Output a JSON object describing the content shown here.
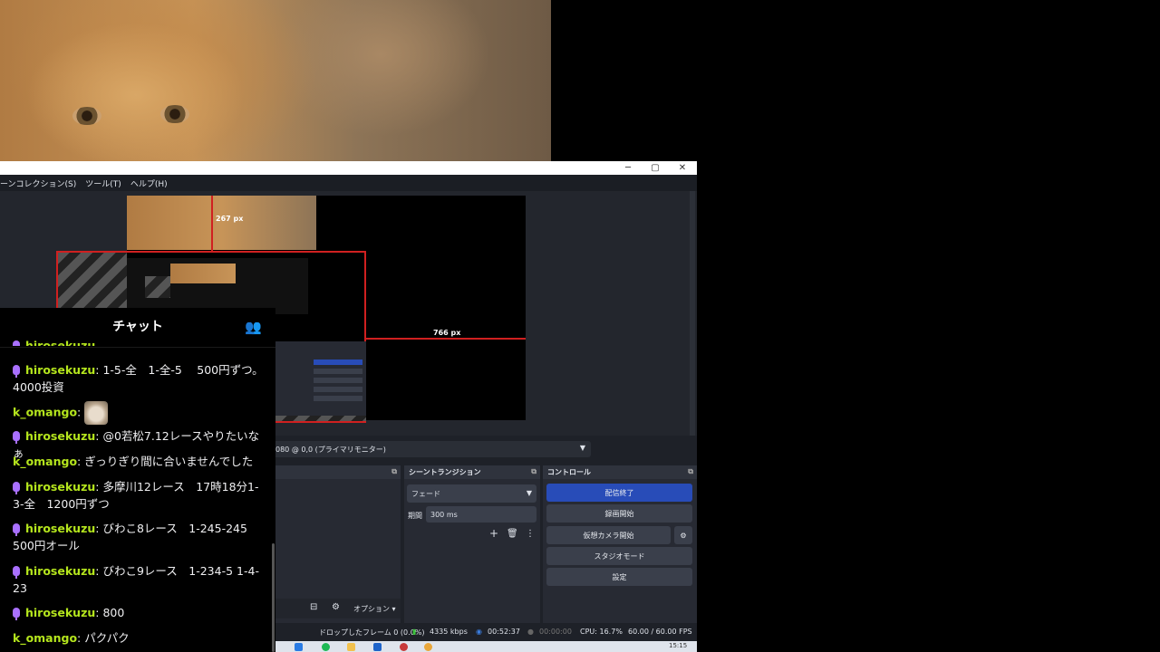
{
  "obs": {
    "window_controls": {
      "minimize": "─",
      "maximize": "▢",
      "close": "✕"
    },
    "menu": [
      "ーンコレクション(S)",
      "ツール(T)",
      "ヘルプ(H)"
    ],
    "preview": {
      "dim_vertical": "267 px",
      "dim_horizontal": "766 px"
    },
    "monitor_select": "080 @ 0,0 (プライマリモニター)",
    "sources_toolbar": {
      "options_label": "オプション ▾"
    },
    "scene_transition": {
      "title": "シーントランジション",
      "type_value": "フェード",
      "duration_label": "期間",
      "duration_value": "300 ms"
    },
    "controls": {
      "title": "コントロール",
      "buttons": [
        "配信終了",
        "録画開始",
        "仮想カメラ開始",
        "スタジオモード",
        "設定"
      ]
    },
    "status": {
      "dropped": "ドロップしたフレーム 0 (0.0%)",
      "bitrate": "4335 kbps",
      "stream_time": "00:52:37",
      "rec_time": "00:00:00",
      "cpu": "CPU: 16.7%",
      "fps": "60.00 / 60.00 FPS"
    },
    "taskbar_clock": "15:15"
  },
  "chat": {
    "title": "チャット",
    "messages": [
      {
        "user": "hirosekuzu",
        "text": "1-5-全　1-全-5　 500円ずつ。4000投資",
        "mic": true
      },
      {
        "user": "k_omango",
        "text": "",
        "mic": false,
        "emote": "cat"
      },
      {
        "user": "hirosekuzu",
        "text": "@0若松7.12レースやりたいなぁ",
        "mic": true
      },
      {
        "user": "k_omango",
        "text": "ぎっりぎり間に合いませんでした",
        "mic": false
      },
      {
        "user": "hirosekuzu",
        "text": "多摩川12レース　17時18分1-3-全　1200円ずつ",
        "mic": true
      },
      {
        "user": "hirosekuzu",
        "text": "びわこ8レース　1-245-245 500円オール",
        "mic": true
      },
      {
        "user": "hirosekuzu",
        "text": "びわこ9レース　1-234-5 1-4-23",
        "mic": true
      },
      {
        "user": "hirosekuzu",
        "text": "800",
        "mic": true
      },
      {
        "user": "k_omango",
        "text": "パクパク",
        "mic": false
      }
    ]
  },
  "colors": {
    "accent": "#284cb8",
    "chat_username": "#b5e61d",
    "mic_badge": "#a970ff",
    "selection_red": "#d02020"
  }
}
